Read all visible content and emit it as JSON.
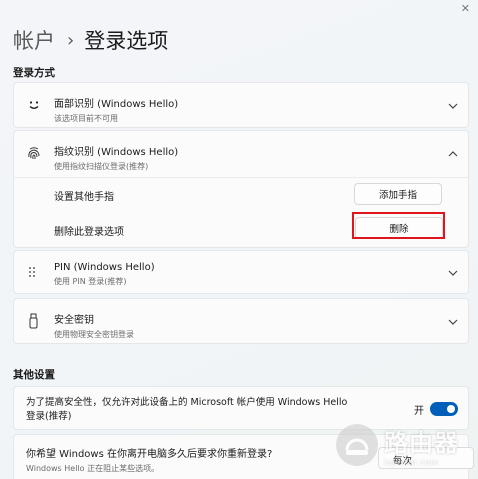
{
  "window": {
    "close_glyph": "✕"
  },
  "breadcrumb": {
    "parent": "帐户",
    "separator": "›",
    "current": "登录选项"
  },
  "sections": {
    "sign_in_methods": "登录方式",
    "other_settings": "其他设置"
  },
  "face": {
    "title": "面部识别 (Windows Hello)",
    "subtitle": "该选项目前不可用",
    "icon": "smiley-icon"
  },
  "fingerprint": {
    "title": "指纹识别 (Windows Hello)",
    "subtitle": "使用指纹扫描仪登录(推荐)",
    "icon": "fingerprint-icon",
    "add_label": "设置其他手指",
    "add_button": "添加手指",
    "remove_label": "删除此登录选项",
    "remove_button": "删除"
  },
  "pin": {
    "title": "PIN (Windows Hello)",
    "subtitle": "使用 PIN 登录(推荐)",
    "icon": "keypad-icon"
  },
  "security_key": {
    "title": "安全密钥",
    "subtitle": "使用物理安全密钥登录",
    "icon": "usb-key-icon"
  },
  "hello_only": {
    "text_line1": "为了提高安全性，仅允许对此设备上的 Microsoft 帐户使用 Windows Hello",
    "text_line2": "登录(推荐)",
    "toggle_label": "开",
    "toggle_on": true
  },
  "away": {
    "title": "你希望 Windows 在你离开电脑多久后要求你重新登录?",
    "subtitle": "Windows Hello 正在阻止某些选项。",
    "select_value": "每次"
  },
  "watermark": {
    "text": "路由器",
    "url": "luyouqi.com"
  },
  "colors": {
    "accent": "#005fb8",
    "highlight": "#e0141c"
  }
}
